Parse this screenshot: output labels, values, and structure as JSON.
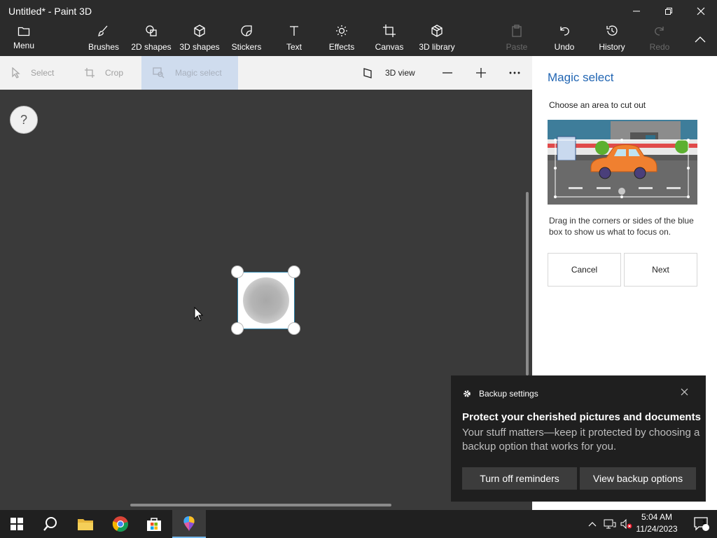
{
  "window": {
    "title": "Untitled* - Paint 3D",
    "min_icon": "minimize-icon",
    "max_icon": "restore-icon",
    "close_icon": "close-icon"
  },
  "ribbon": {
    "menu": "Menu",
    "brushes": "Brushes",
    "shapes2d": "2D shapes",
    "shapes3d": "3D shapes",
    "stickers": "Stickers",
    "text": "Text",
    "effects": "Effects",
    "canvas": "Canvas",
    "library3d": "3D library",
    "paste": "Paste",
    "undo": "Undo",
    "history": "History",
    "redo": "Redo"
  },
  "toolbar": {
    "select": "Select",
    "crop": "Crop",
    "magic_select": "Magic select",
    "view3d": "3D view"
  },
  "canvas": {
    "help": "?"
  },
  "panel": {
    "title": "Magic select",
    "subtitle": "Choose an area to cut out",
    "description": "Drag in the corners or sides of the blue box to show us what to focus on.",
    "cancel": "Cancel",
    "next": "Next"
  },
  "toast": {
    "app": "Backup settings",
    "heading": "Protect your cherished pictures and documents",
    "body": "Your stuff matters—keep it protected by choosing a backup option that works for you.",
    "turn_off": "Turn off reminders",
    "view_options": "View backup options"
  },
  "taskbar": {
    "time": "5:04 AM",
    "date": "11/24/2023",
    "notification_count": "1"
  },
  "colors": {
    "accent": "#2266b3",
    "magic_bg": "#cfdcee",
    "canvas_bg": "#3a3a3a"
  }
}
